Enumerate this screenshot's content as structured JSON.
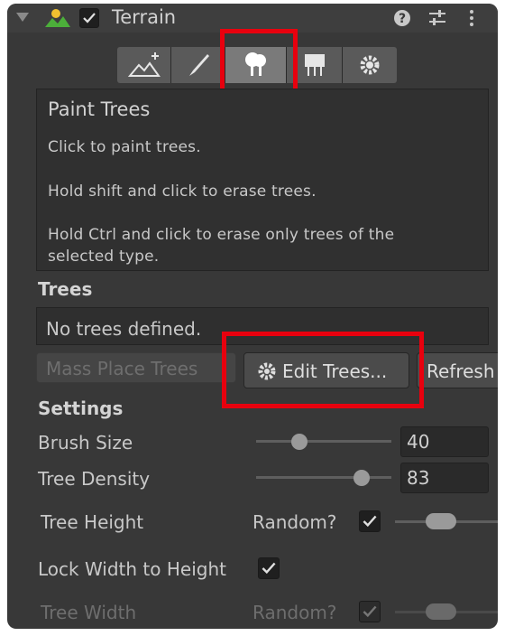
{
  "header": {
    "title": "Terrain",
    "enabled": true
  },
  "toolbar": {
    "tools": [
      {
        "name": "raise-terrain-tool",
        "icon": "mountain-plus-icon"
      },
      {
        "name": "paint-texture-tool",
        "icon": "brush-icon"
      },
      {
        "name": "paint-trees-tool",
        "icon": "tree-icon",
        "selected": true
      },
      {
        "name": "paint-details-tool",
        "icon": "flowers-icon"
      },
      {
        "name": "settings-tool",
        "icon": "gear-icon"
      }
    ]
  },
  "help": {
    "title": "Paint Trees",
    "line1": "Click to paint trees.",
    "line2": "Hold shift and click to erase trees.",
    "line3": "Hold Ctrl and click to erase only trees of the",
    "line4": "selected type."
  },
  "trees": {
    "heading": "Trees",
    "empty_message": "No trees defined.",
    "mass_place_label": "Mass Place Trees",
    "edit_trees_label": "Edit Trees...",
    "refresh_label": "Refresh"
  },
  "settings": {
    "heading": "Settings",
    "brush_size_label": "Brush Size",
    "brush_size_value": "40",
    "brush_size_fraction": 0.32,
    "tree_density_label": "Tree Density",
    "tree_density_value": "83",
    "tree_density_fraction": 0.78,
    "tree_height_label": "Tree Height",
    "random_label": "Random?",
    "tree_height_random": true,
    "lock_label": "Lock Width to Height",
    "lock_checked": true,
    "tree_width_label": "Tree Width",
    "tree_width_random_label": "Random?"
  },
  "colors": {
    "panel": "#383838",
    "highlight": "#e8000e",
    "selected_tool": "#7a7a7a"
  }
}
